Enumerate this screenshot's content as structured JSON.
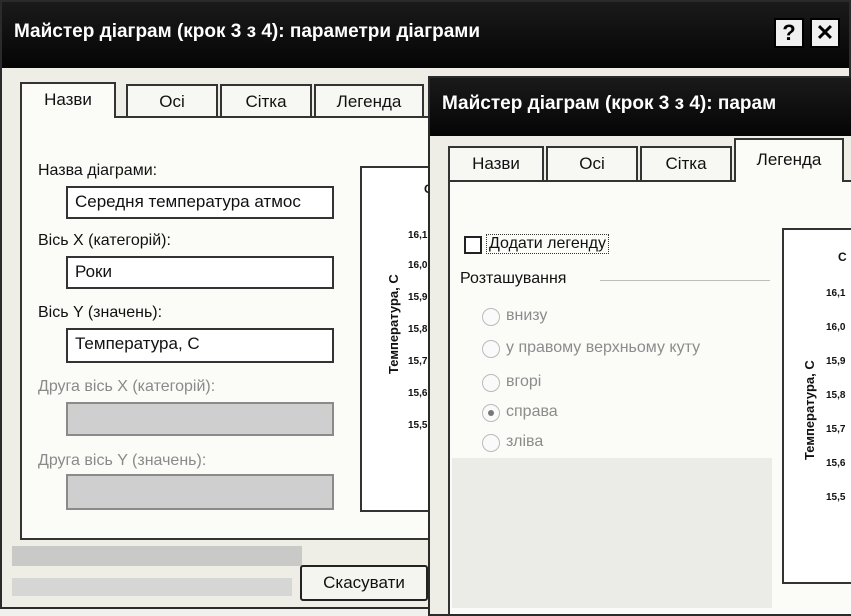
{
  "dialog_back": {
    "title": "Майстер діаграм (крок 3 з 4): параметри діаграми",
    "help_label": "?",
    "close_label": "✕",
    "tabs": [
      "Назви",
      "Осі",
      "Сітка",
      "Легенда"
    ],
    "fields": {
      "chart_title_label": "Назва діаграми:",
      "chart_title_value": "Середня температура атмос",
      "x_axis_label": "Вісь X (категорій):",
      "x_axis_value": "Роки",
      "y_axis_label": "Вісь Y (значень):",
      "y_axis_value": "Температура, С",
      "x2_axis_label": "Друга вісь X (категорій):",
      "y2_axis_label": "Друга вісь Y (значень):"
    },
    "preview": {
      "ylabel": "Температура, С",
      "ticks": [
        "16,1",
        "16,0",
        "15,9",
        "15,8",
        "15,7",
        "15,6",
        "15,5"
      ],
      "title_fragment": "С"
    },
    "cancel_label": "Скасувати"
  },
  "dialog_front": {
    "title": "Майстер діаграм (крок 3 з 4): парам",
    "tabs": [
      "Назви",
      "Осі",
      "Сітка",
      "Легенда"
    ],
    "active_tab": "Легенда",
    "add_legend_label": "Додати легенду",
    "add_legend_checked": false,
    "placement_label": "Розташування",
    "placement_options": [
      "внизу",
      "у правому верхньому куту",
      "вгорі",
      "справа",
      "зліва"
    ],
    "placement_selected": "справа",
    "preview": {
      "ylabel": "Температура, С",
      "ticks": [
        "16,1",
        "16,0",
        "15,9",
        "15,8",
        "15,7",
        "15,6",
        "15,5"
      ],
      "title_fragment": "С"
    }
  }
}
